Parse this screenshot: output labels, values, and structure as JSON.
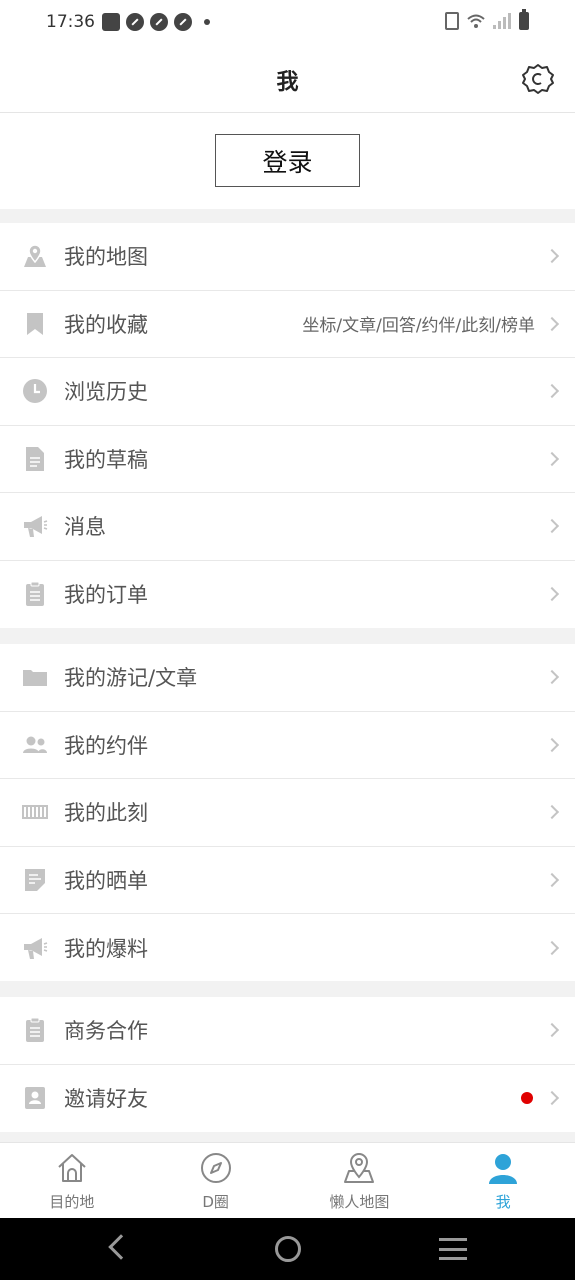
{
  "status_bar": {
    "time": "17:36"
  },
  "header": {
    "title": "我"
  },
  "login": {
    "label": "登录"
  },
  "menu_groups": [
    [
      {
        "label": "我的地图",
        "icon": "map-icon"
      },
      {
        "label": "我的收藏",
        "icon": "bookmark-icon",
        "sub": "坐标/文章/回答/约伴/此刻/榜单"
      },
      {
        "label": "浏览历史",
        "icon": "clock-icon"
      },
      {
        "label": "我的草稿",
        "icon": "document-icon"
      },
      {
        "label": "消息",
        "icon": "megaphone-icon"
      },
      {
        "label": "我的订单",
        "icon": "clipboard-icon"
      }
    ],
    [
      {
        "label": "我的游记/文章",
        "icon": "folder-icon"
      },
      {
        "label": "我的约伴",
        "icon": "people-icon"
      },
      {
        "label": "我的此刻",
        "icon": "film-icon"
      },
      {
        "label": "我的晒单",
        "icon": "receipt-icon"
      },
      {
        "label": "我的爆料",
        "icon": "megaphone-icon"
      }
    ],
    [
      {
        "label": "商务合作",
        "icon": "clipboard-icon"
      },
      {
        "label": "邀请好友",
        "icon": "contact-icon",
        "badge": "red-dot"
      }
    ]
  ],
  "tabs": [
    {
      "label": "目的地",
      "icon": "home-icon"
    },
    {
      "label": "D圈",
      "icon": "compass-icon"
    },
    {
      "label": "懒人地图",
      "icon": "map-pin-icon"
    },
    {
      "label": "我",
      "icon": "user-icon",
      "active": true
    }
  ],
  "colors": {
    "accent": "#2ea3d8",
    "icon_gray": "#c4c4c4",
    "badge_red": "#e00000"
  }
}
